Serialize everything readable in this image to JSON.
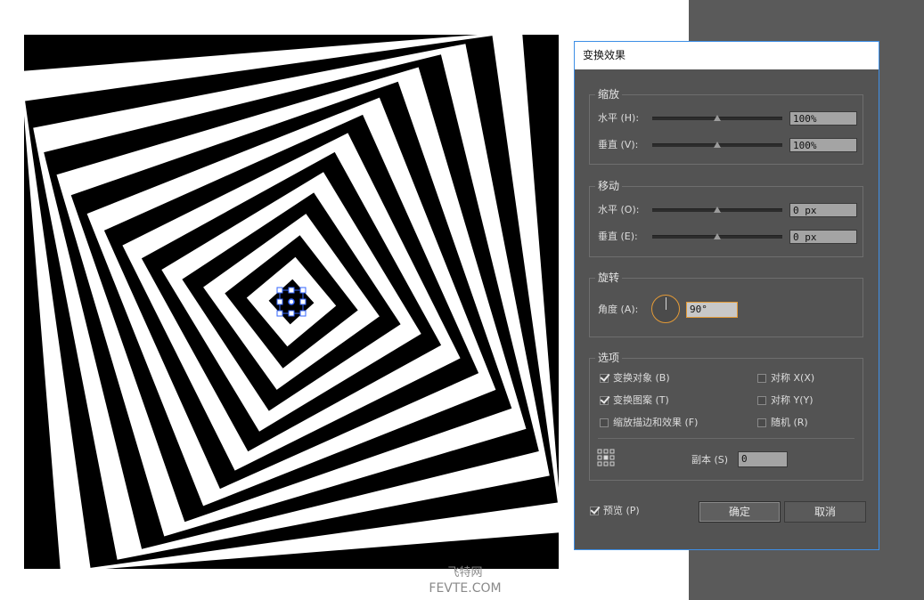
{
  "watermark": {
    "line1": "飞特网",
    "line2": "FEVTE.COM"
  },
  "dialog": {
    "title": "变换效果",
    "scale": {
      "title": "缩放",
      "horizontal_label": "水平 (H):",
      "horizontal_value": "100%",
      "vertical_label": "垂直 (V):",
      "vertical_value": "100%"
    },
    "move": {
      "title": "移动",
      "horizontal_label": "水平 (O):",
      "horizontal_value": "0 px",
      "vertical_label": "垂直 (E):",
      "vertical_value": "0 px"
    },
    "rotate": {
      "title": "旋转",
      "angle_label": "角度 (A):",
      "angle_value": "90°"
    },
    "options": {
      "title": "选项",
      "transform_objects": {
        "label": "变换对象 (B)",
        "checked": true
      },
      "transform_patterns": {
        "label": "变换图案 (T)",
        "checked": true
      },
      "scale_strokes": {
        "label": "缩放描边和效果 (F)",
        "checked": false
      },
      "reflect_x": {
        "label": "对称 X(X)",
        "checked": false
      },
      "reflect_y": {
        "label": "对称 Y(Y)",
        "checked": false
      },
      "random": {
        "label": "随机 (R)",
        "checked": false
      },
      "copies_label": "副本 (S)",
      "copies_value": "0"
    },
    "preview": {
      "label": "预览 (P)",
      "checked": true
    },
    "ok_label": "确定",
    "cancel_label": "取消"
  },
  "colors": {
    "dialog_bg": "#535353",
    "dialog_border": "#3d8ee6",
    "focus_accent": "#e39a37",
    "pasteboard": "#5a5a5a",
    "selection": "#3366ff"
  }
}
